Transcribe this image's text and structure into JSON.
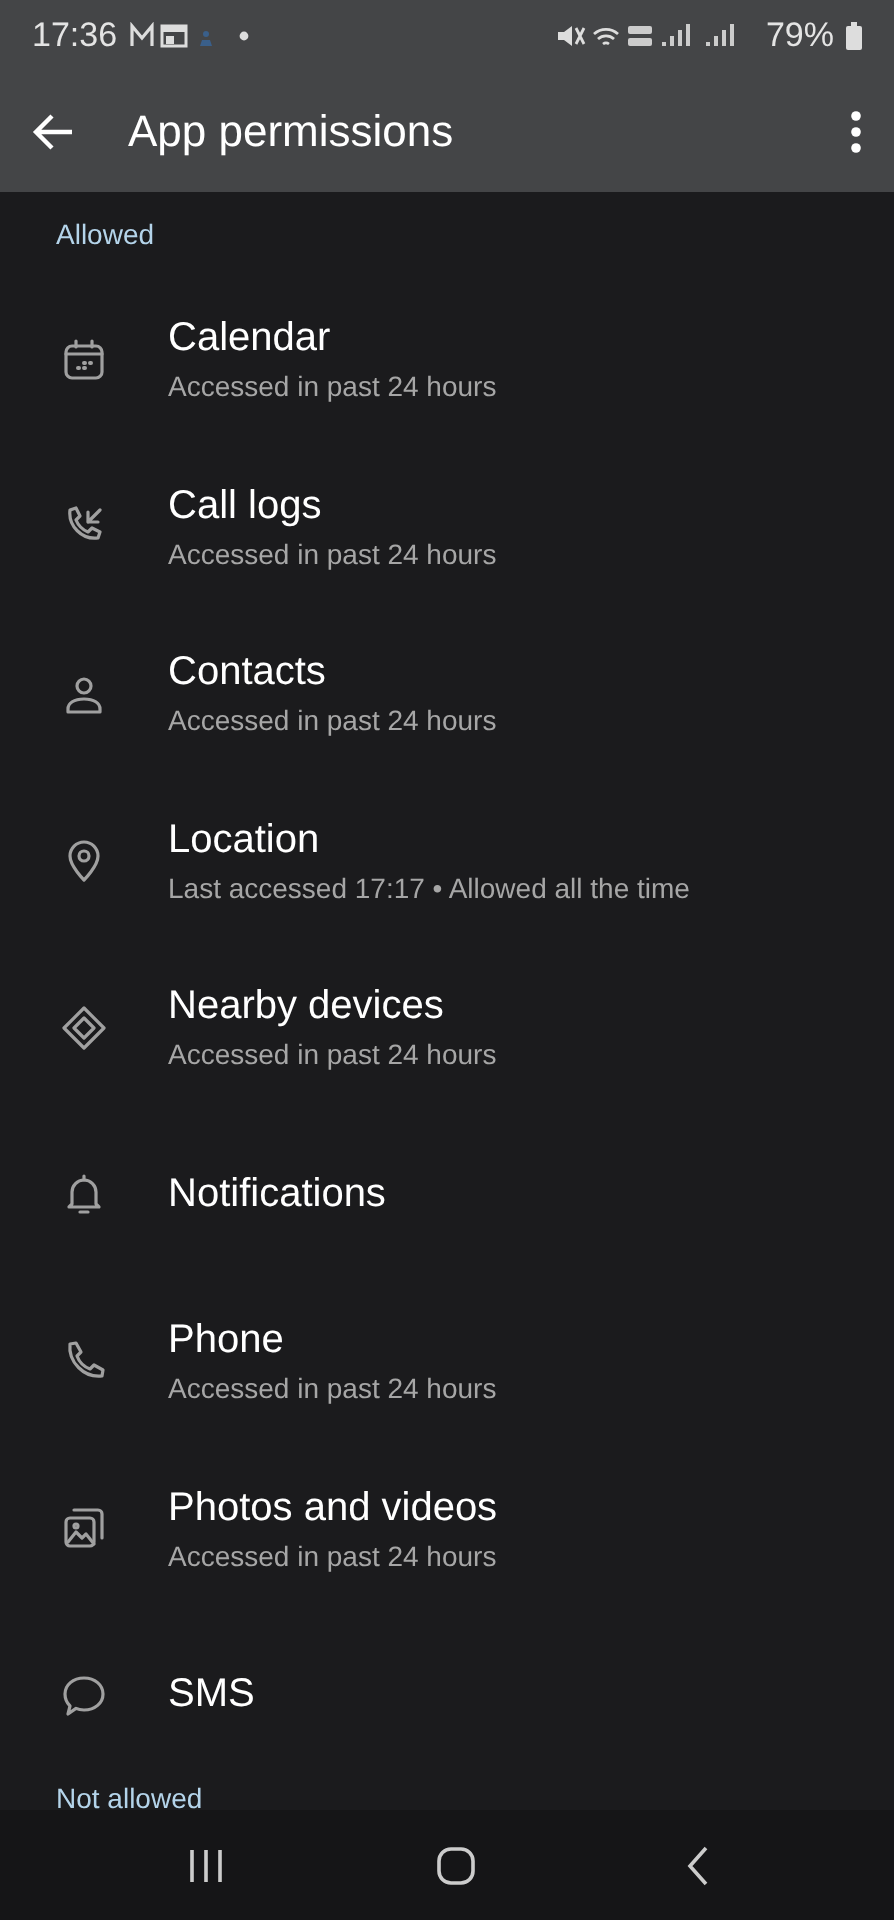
{
  "status_bar": {
    "time": "17:36",
    "battery": "79%"
  },
  "app_bar": {
    "title": "App permissions"
  },
  "sections": [
    {
      "header": "Allowed",
      "items": [
        {
          "title": "Calendar",
          "subtitle": "Accessed in past 24 hours"
        },
        {
          "title": "Call logs",
          "subtitle": "Accessed in past 24 hours"
        },
        {
          "title": "Contacts",
          "subtitle": "Accessed in past 24 hours"
        },
        {
          "title": "Location",
          "subtitle": "Last accessed 17:17 • Allowed all the time"
        },
        {
          "title": "Nearby devices",
          "subtitle": "Accessed in past 24 hours"
        },
        {
          "title": "Notifications"
        },
        {
          "title": "Phone",
          "subtitle": "Accessed in past 24 hours"
        },
        {
          "title": "Photos and videos",
          "subtitle": "Accessed in past 24 hours"
        },
        {
          "title": "SMS"
        }
      ]
    },
    {
      "header": "Not allowed"
    }
  ]
}
